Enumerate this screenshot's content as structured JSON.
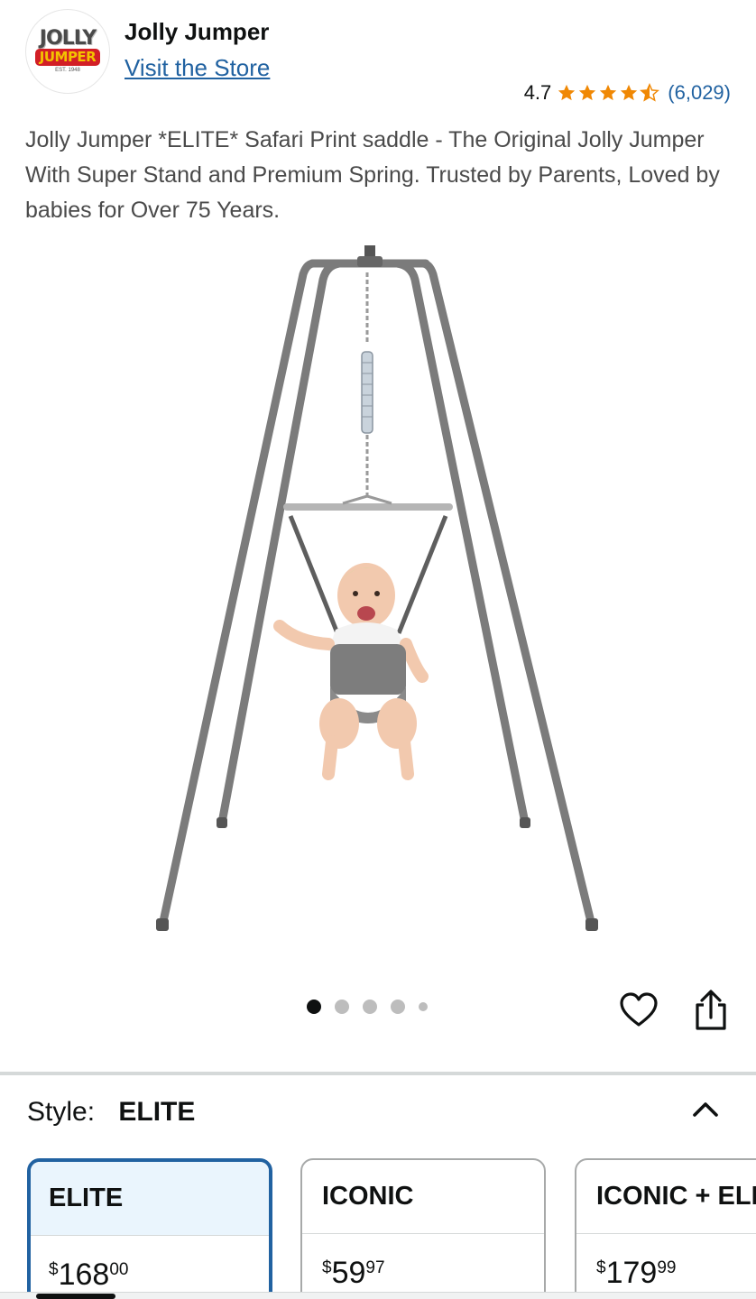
{
  "brand": {
    "logo_top": "JOLLY",
    "logo_bottom": "JUMPER",
    "logo_est": "EST. 1948",
    "name": "Jolly Jumper",
    "store_link": "Visit the Store"
  },
  "rating": {
    "value": "4.7",
    "stars": 4.5,
    "star_color": "#f08804",
    "count": "(6,029)"
  },
  "product": {
    "title": "Jolly Jumper *ELITE* Safari Print saddle - The Original Jolly Jumper With Super Stand and Premium Spring. Trusted by Parents, Loved by babies for Over 75 Years.",
    "image_icon": "baby-jumper-stand-image",
    "image_count": 5,
    "active_image": 1
  },
  "style": {
    "label": "Style:",
    "value": "ELITE",
    "options": [
      {
        "name": "ELITE",
        "currency": "$",
        "dollars": "168",
        "cents": "00",
        "selected": true
      },
      {
        "name": "ICONIC",
        "currency": "$",
        "dollars": "59",
        "cents": "97",
        "selected": false
      },
      {
        "name": "ICONIC + ELITE",
        "currency": "$",
        "dollars": "179",
        "cents": "99",
        "selected": false
      }
    ]
  },
  "colors": {
    "link": "#2162a1",
    "selected_border": "#2162a1",
    "selected_bg": "#eaf5fd",
    "star": "#f08804"
  }
}
